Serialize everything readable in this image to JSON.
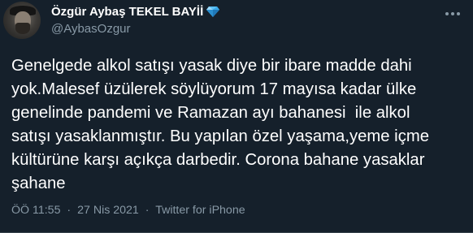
{
  "author": {
    "display_name": "Özgür Aybaş TEKEL BAYİİ",
    "badge_icon": "gem-icon",
    "handle": "@AybasOzgur"
  },
  "tweet": {
    "text": "Genelgede alkol satışı yasak diye bir ibare madde dahi\nyok.Malesef üzülerek söylüyorum 17 mayısa kadar ülke\ngenelinde pandemi ve Ramazan ayı bahanesi  ile alkol\nsatışı yasaklanmıştır. Bu yapılan özel yaşama,yeme içme\nkültürüne karşı açıkça darbedir. Corona bahane yasaklar\nşahane",
    "time": "ÖÖ 11:55",
    "separator": "·",
    "date": "27 Nis 2021",
    "source": "Twitter for iPhone"
  },
  "colors": {
    "background": "#15202b",
    "text": "#ffffff",
    "secondary": "#8899a6",
    "gem": "#1da1f2"
  }
}
